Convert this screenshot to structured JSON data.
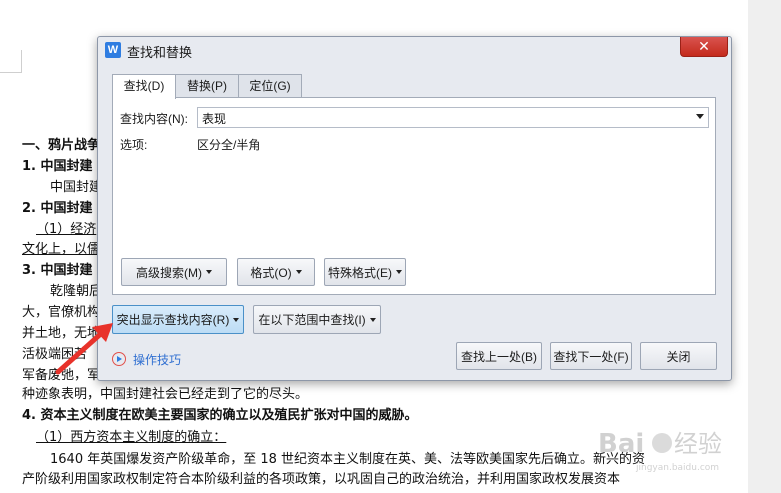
{
  "document": {
    "lines": [
      {
        "text": "一、鸦片战争",
        "bold": true
      },
      {
        "text": "1.  中国封建",
        "bold": true
      },
      {
        "text": "中国封建",
        "bold": false
      },
      {
        "text": "2.  中国封建",
        "bold": true
      },
      {
        "text": "（1）经济",
        "bold": false
      },
      {
        "text": "文化上，以儒",
        "bold": false
      },
      {
        "text": "3.  中国封建",
        "bold": true
      },
      {
        "text": "乾隆朝后",
        "bold": false
      },
      {
        "text": "大，官僚机构",
        "bold": false
      },
      {
        "text": "并土地，无地",
        "bold": false
      },
      {
        "text": "活极端困苦",
        "bold": false
      },
      {
        "text": "军备废弛，军",
        "bold": false
      },
      {
        "text": "种迹象表明，中国封建社会已经走到了它的尽头。",
        "bold": false
      },
      {
        "text": "4.  资本主义制度在欧美主要国家的确立以及殖民扩张对中国的威胁。",
        "bold": true
      },
      {
        "text": "（1）西方资本主义制度的确立：",
        "bold": false
      },
      {
        "text": "1640 年英国爆发资产阶级革命，至 18 世纪资本主义制度在英、美、法等欧美国家先后确立。新兴的资",
        "bold": false
      },
      {
        "text": "产阶级利用国家政权制定符合本阶级利益的各项政策，以巩固自己的政治统治，并利用国家政权发展资本",
        "bold": false
      }
    ]
  },
  "dialog": {
    "title": "查找和替换",
    "app_icon": "W",
    "close_label": "✕",
    "tabs": [
      {
        "label": "查找(D)",
        "active": true
      },
      {
        "label": "替换(P)",
        "active": false
      },
      {
        "label": "定位(G)",
        "active": false
      }
    ],
    "find_label": "查找内容(N):",
    "find_value": "表现",
    "options_label": "选项:",
    "options_value": "区分全/半角",
    "buttons": {
      "advanced": "高级搜索(M)",
      "format": "格式(O)",
      "special": "特殊格式(E)",
      "highlight": "突出显示查找内容(R)",
      "find_in": "在以下范围中查找(I)",
      "find_prev": "查找上一处(B)",
      "find_next": "查找下一处(F)",
      "close": "关闭"
    },
    "tips_label": "操作技巧"
  },
  "watermark": {
    "text": "Bai du 经验",
    "sub": "jingyan.baidu.com"
  },
  "colors": {
    "dialog_bg": "#e7eaf0",
    "close_red": "#c42b1c",
    "arrow_red": "#e8322a",
    "link_blue": "#2f6fd1"
  }
}
